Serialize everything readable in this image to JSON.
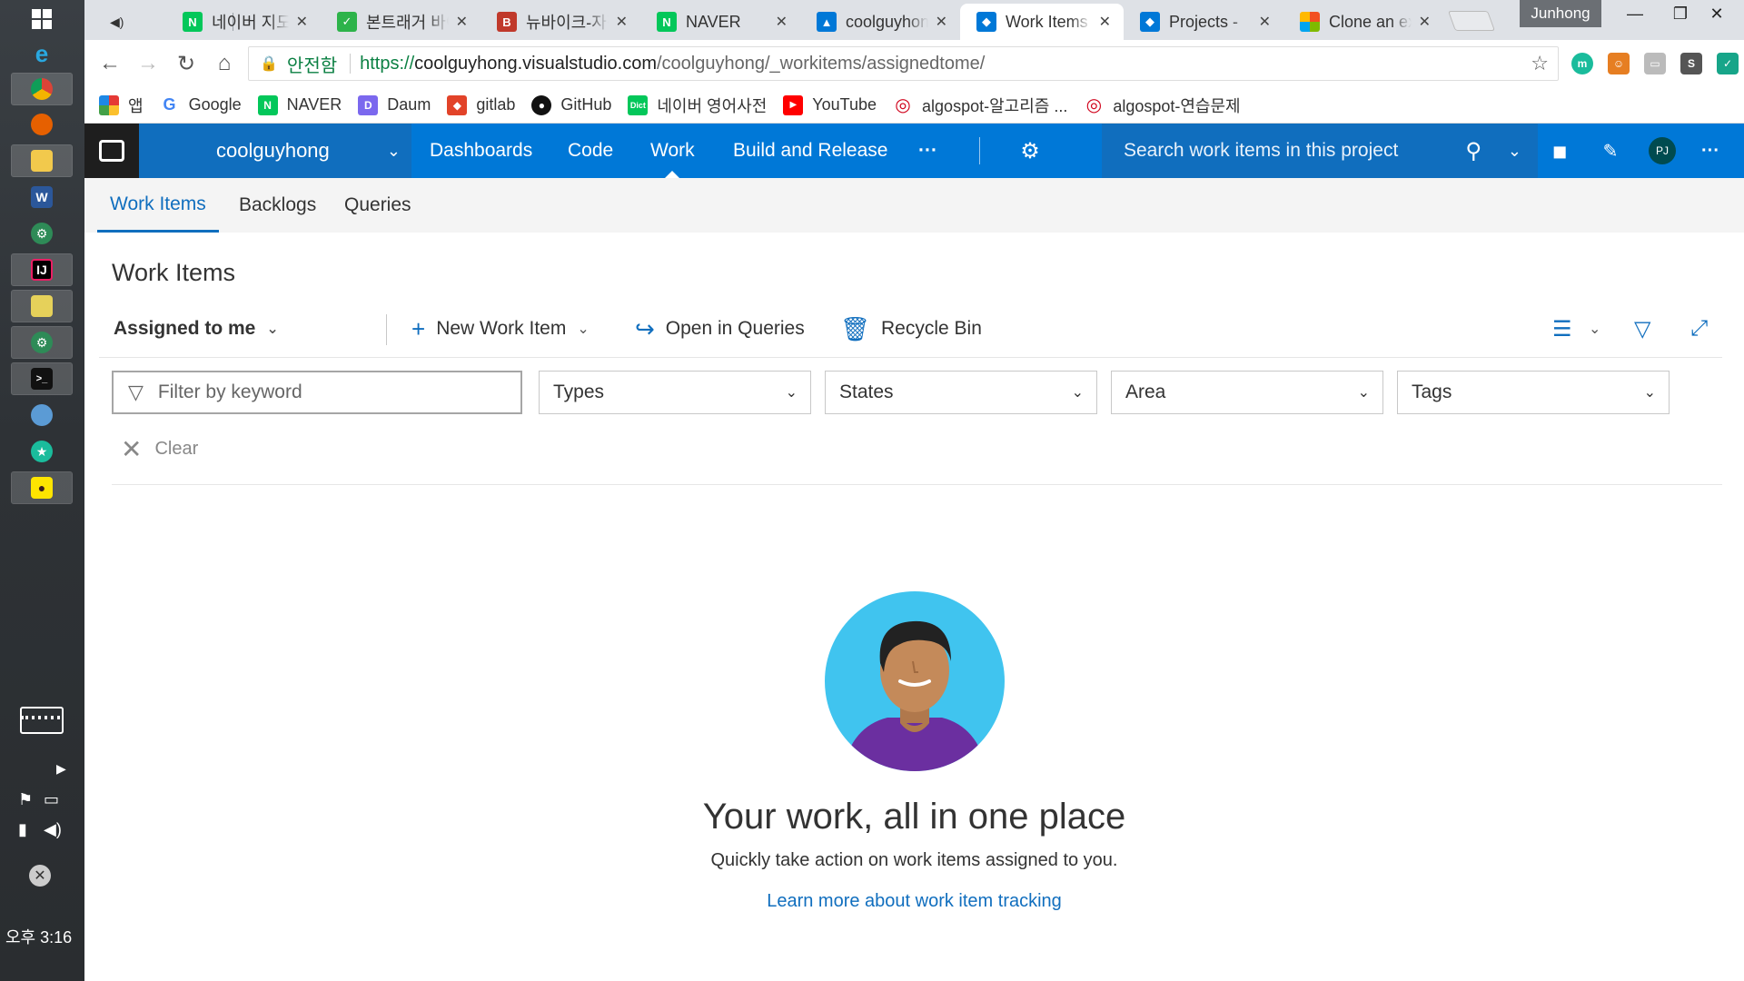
{
  "taskbar": {
    "clock": "오후 3:16"
  },
  "browser": {
    "tabs": [
      {
        "title": "네이버 지도",
        "favicon": "naver-icon",
        "color": "#03c75a",
        "glyph": "N"
      },
      {
        "title": "본트래거 바이크",
        "favicon": "note-icon",
        "color": "#2db34a",
        "glyph": "✓"
      },
      {
        "title": "뉴바이크-자전거",
        "favicon": "bike-icon",
        "color": "#c0392b",
        "glyph": "B"
      },
      {
        "title": "NAVER",
        "favicon": "naver-icon",
        "color": "#03c75a",
        "glyph": "N"
      },
      {
        "title": "coolguyhong",
        "favicon": "azure-icon",
        "color": "#0078d7",
        "glyph": "▲"
      },
      {
        "title": "Work Items",
        "favicon": "vsts-icon",
        "color": "#0078d7",
        "glyph": "◆"
      },
      {
        "title": "Projects - ",
        "favicon": "vsts-icon",
        "color": "#0078d7",
        "glyph": "◆"
      },
      {
        "title": "Clone an existing",
        "favicon": "microsoft-icon",
        "color": "#f25022",
        "glyph": "■"
      }
    ],
    "profile": "Junhong",
    "address": {
      "secure_label": "안전함",
      "scheme": "https://",
      "host": "coolguyhong.visualstudio.com",
      "path": "/coolguyhong/_workitems/assignedtome/"
    },
    "bookmarks": [
      {
        "label": "앱",
        "icon": "apps-icon",
        "color": "#e53935",
        "glyph": "⋮⋮"
      },
      {
        "label": "Google",
        "icon": "google-icon",
        "color": "#4285f4",
        "glyph": "G"
      },
      {
        "label": "NAVER",
        "icon": "naver-icon",
        "color": "#03c75a",
        "glyph": "N"
      },
      {
        "label": "Daum",
        "icon": "daum-icon",
        "color": "#7b68ee",
        "glyph": "D"
      },
      {
        "label": "gitlab",
        "icon": "gitlab-icon",
        "color": "#e24329",
        "glyph": "◆"
      },
      {
        "label": "GitHub",
        "icon": "github-icon",
        "color": "#111111",
        "glyph": "●"
      },
      {
        "label": "네이버 영어사전",
        "icon": "dict-icon",
        "color": "#03c75a",
        "glyph": "D"
      },
      {
        "label": "YouTube",
        "icon": "youtube-icon",
        "color": "#ff0000",
        "glyph": "▶"
      },
      {
        "label": "algospot-알고리즘 ...",
        "icon": "algospot-icon",
        "color": "#d0021b",
        "glyph": "◎"
      },
      {
        "label": "algospot-연습문제",
        "icon": "algospot-icon",
        "color": "#d0021b",
        "glyph": "◎"
      }
    ]
  },
  "vsts": {
    "project": "coolguyhong",
    "hubs": [
      "Dashboards",
      "Code",
      "Work",
      "Build and Release"
    ],
    "more": "···",
    "search_placeholder": "Search work items in this project",
    "avatar_initials": "PJ",
    "subtabs": [
      "Work Items",
      "Backlogs",
      "Queries"
    ],
    "page_title": "Work Items",
    "commands": {
      "view": "Assigned to me",
      "new_item": "New Work Item",
      "open_queries": "Open in Queries",
      "recycle": "Recycle Bin"
    },
    "filters": {
      "keyword_placeholder": "Filter by keyword",
      "types": "Types",
      "states": "States",
      "area": "Area",
      "tags": "Tags",
      "clear": "Clear"
    },
    "empty": {
      "heading": "Your work, all in one place",
      "subtext": "Quickly take action on work items assigned to you.",
      "link": "Learn more about work item tracking"
    }
  },
  "colors": {
    "accent": "#0078d7",
    "accent_dark": "#106ebe"
  }
}
